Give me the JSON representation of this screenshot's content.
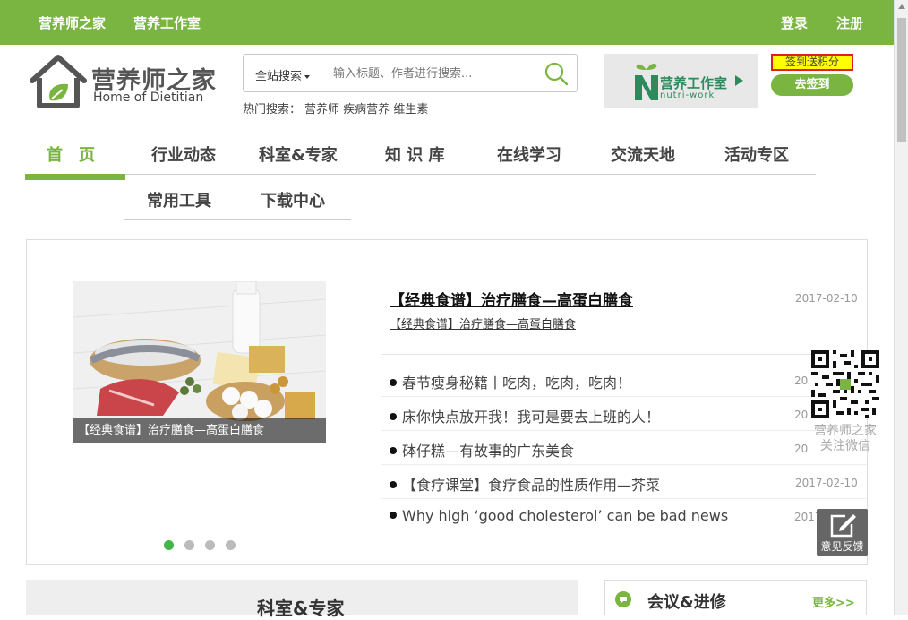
{
  "topbar": {
    "links": [
      "营养师之家",
      "营养工作室"
    ],
    "login": "登录",
    "register": "注册"
  },
  "logo": {
    "cn": "营养师之家",
    "en": "Home of Dietitian"
  },
  "search": {
    "scope": "全站搜索",
    "placeholder": "输入标题、作者进行搜索...",
    "hot_label": "热门搜索：",
    "hot_terms": [
      "营养师",
      "疾病营养",
      "维生素"
    ]
  },
  "banner": {
    "title": "营养工作室",
    "subtitle": "nutri-work"
  },
  "sign": {
    "note": "签到送积分",
    "button": "去签到"
  },
  "nav": {
    "items": [
      "首　页",
      "行业动态",
      "科室&专家",
      "知 识 库",
      "在线学习",
      "交流天地",
      "活动专区",
      "常用工具",
      "下载中心"
    ]
  },
  "featured": {
    "caption": "【经典食谱】治疗膳食—高蛋白膳食",
    "headline": "【经典食谱】治疗膳食—高蛋白膳食",
    "headline_date": "2017-02-10",
    "subline": "【经典食谱】治疗膳食—高蛋白膳食"
  },
  "news": [
    {
      "title": "春节瘦身秘籍丨吃肉，吃肉，吃肉！",
      "date": "20"
    },
    {
      "title": "床你快点放开我！我可是要去上班的人！",
      "date": "20"
    },
    {
      "title": "砵仔糕—有故事的广东美食",
      "date": "20"
    },
    {
      "title": "【食疗课堂】食疗食品的性质作用—芥菜",
      "date": "2017-02-10"
    },
    {
      "title": "Why high ‘good cholesterol’ can be bad news",
      "date": "2017"
    }
  ],
  "qr": {
    "line1": "营养师之家",
    "line2": "关注微信"
  },
  "feedback": {
    "label": "意见反馈"
  },
  "sections": {
    "left_title": "科室&专家",
    "right_title": "会议&进修",
    "right_more": "更多>>"
  },
  "colors": {
    "brand_green": "#7ab541",
    "sign_highlight": "#ffff00",
    "sign_border": "#e02020"
  }
}
